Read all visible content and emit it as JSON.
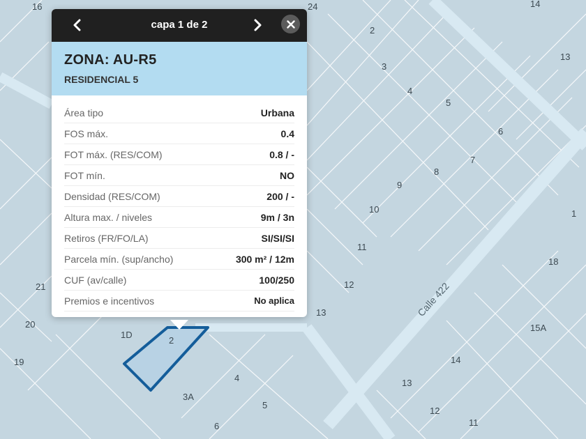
{
  "popup": {
    "layer_label": "capa 1 de 2",
    "zone_title": "ZONA: AU-R5",
    "zone_subtitle": "RESIDENCIAL 5",
    "rows": [
      {
        "label": "Área tipo",
        "value": "Urbana"
      },
      {
        "label": "FOS máx.",
        "value": "0.4"
      },
      {
        "label": "FOT máx. (RES/COM)",
        "value": "0.8 / -"
      },
      {
        "label": "FOT mín.",
        "value": "NO"
      },
      {
        "label": "Densidad (RES/COM)",
        "value": "200 / -"
      },
      {
        "label": "Altura max. / niveles",
        "value": "9m / 3n"
      },
      {
        "label": "Retiros (FR/FO/LA)",
        "value": "SI/SI/SI"
      },
      {
        "label": "Parcela mín. (sup/ancho)",
        "value": "300 m² / 12m"
      },
      {
        "label": "CUF (av/calle)",
        "value": "100/250"
      },
      {
        "label": "Premios e incentivos",
        "value": "No aplica"
      }
    ]
  },
  "map": {
    "street_label": "Calle 422",
    "parcel_labels": [
      "16",
      "24",
      "14",
      "2",
      "13",
      "3",
      "4",
      "5",
      "6",
      "7",
      "8",
      "9",
      "10",
      "11",
      "12",
      "13",
      "1",
      "18",
      "15A",
      "21",
      "20",
      "19",
      "1D",
      "2",
      "4",
      "3A",
      "5",
      "6",
      "14",
      "13",
      "12",
      "11"
    ],
    "colors": {
      "background": "#c4d6e0",
      "street": "#d8e9f2",
      "selected_outline": "#145d9a"
    }
  },
  "icons": {
    "prev": "chevron-left-icon",
    "next": "chevron-right-icon",
    "close": "close-icon"
  }
}
